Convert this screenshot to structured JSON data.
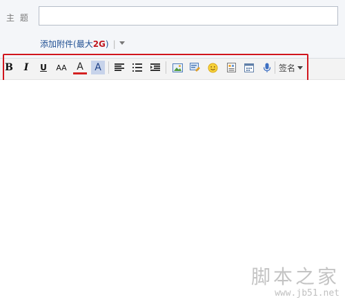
{
  "subject": {
    "label": "主 题",
    "value": "",
    "placeholder": ""
  },
  "attachment": {
    "label": "添加附件",
    "size_open": "(最大",
    "size_value": "2G",
    "size_close": ")",
    "separator": "|"
  },
  "toolbar": {
    "bold": "B",
    "italic": "I",
    "underline": "U",
    "font_size": "AA",
    "font_color": "A",
    "highlight": "A",
    "signature_label": "签名"
  },
  "watermark": {
    "title": "脚本之家",
    "url": "www.jb51.net"
  },
  "colors": {
    "highlight_border": "#d0141c",
    "link": "#1f4f93",
    "size_accent": "#c0161e"
  }
}
